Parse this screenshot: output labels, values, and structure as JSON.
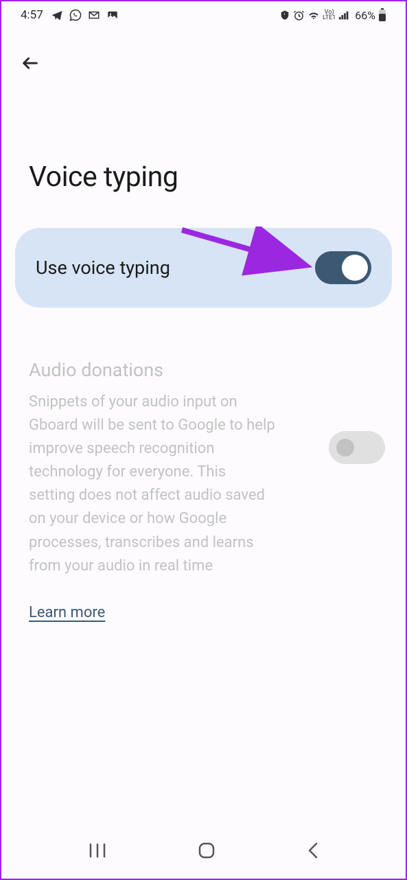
{
  "statusBar": {
    "time": "4:57",
    "batteryPercent": "66%"
  },
  "pageTitle": "Voice typing",
  "mainToggle": {
    "label": "Use voice typing",
    "enabled": true
  },
  "audioSection": {
    "title": "Audio donations",
    "description": "Snippets of your audio input on Gboard will be sent to Google to help improve speech recognition technology for everyone. This setting does not affect audio saved on your device or how Google processes, transcribes and learns from your audio in real time",
    "learnMore": "Learn more",
    "enabled": false
  }
}
